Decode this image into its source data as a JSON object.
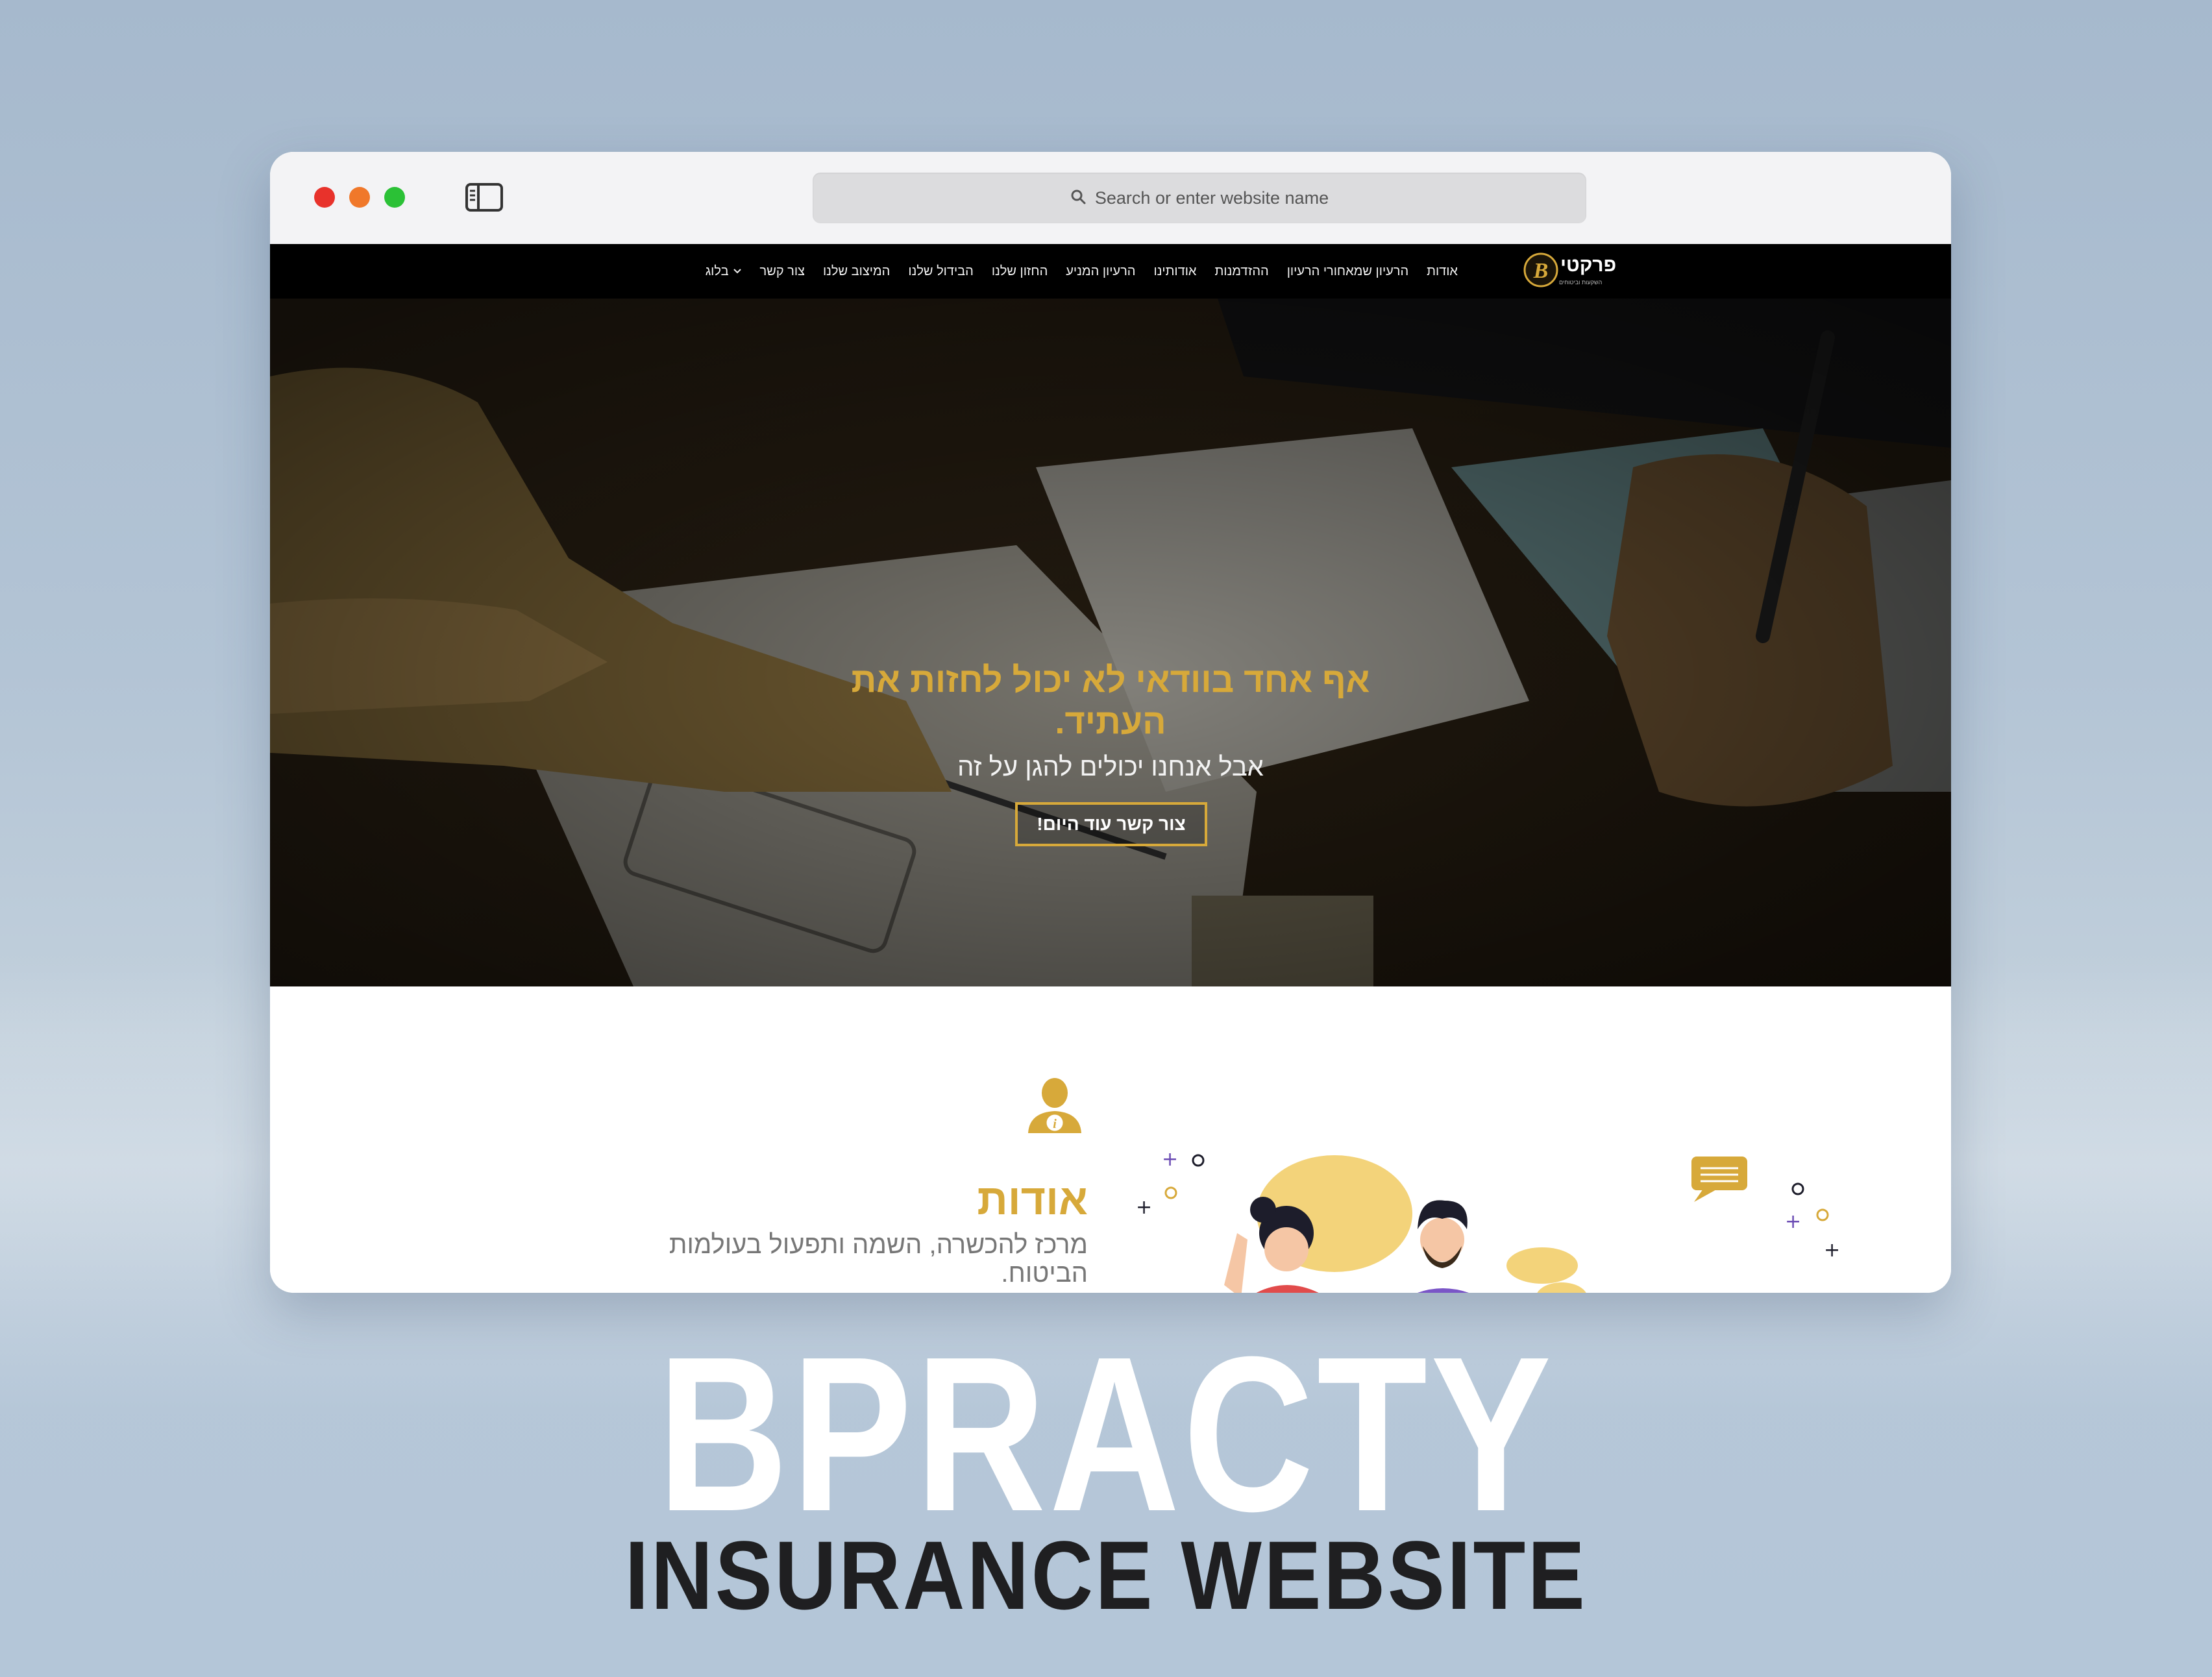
{
  "browser": {
    "url_placeholder": "Search or enter website name",
    "icons": [
      "sidebar-icon",
      "chevron-left-icon",
      "chevron-right-icon",
      "plus-icon",
      "tabs-icon",
      "search-icon"
    ]
  },
  "site": {
    "logo_text": "פרקטי",
    "logo_letter": "B",
    "logo_subtitle": "השקעות וביטוחים",
    "nav": [
      {
        "label": "אודות"
      },
      {
        "label": "הרעיון שמאחורי הרעיון"
      },
      {
        "label": "ההזדמנות"
      },
      {
        "label": "אודותינו"
      },
      {
        "label": "הרעיון המניע"
      },
      {
        "label": "החזון שלנו"
      },
      {
        "label": "הבידול שלנו"
      },
      {
        "label": "המיצוב שלנו"
      },
      {
        "label": "צור קשר"
      },
      {
        "label": "בלוג"
      }
    ],
    "hero": {
      "title": "אף אחד בוודאי לא יכול לחזות את העתיד.",
      "subtitle": "אבל אנחנו יכולים להגן על זה",
      "cta": "צור קשר עוד היום!"
    },
    "about": {
      "title": "אודות",
      "text": "מרכז להכשרה, השמה ותפעול בעולמות הביטוח."
    },
    "accent_color": "#d7a93a"
  },
  "caption": {
    "title": "BPRACTY",
    "subtitle": "INSURANCE WEBSITE"
  }
}
